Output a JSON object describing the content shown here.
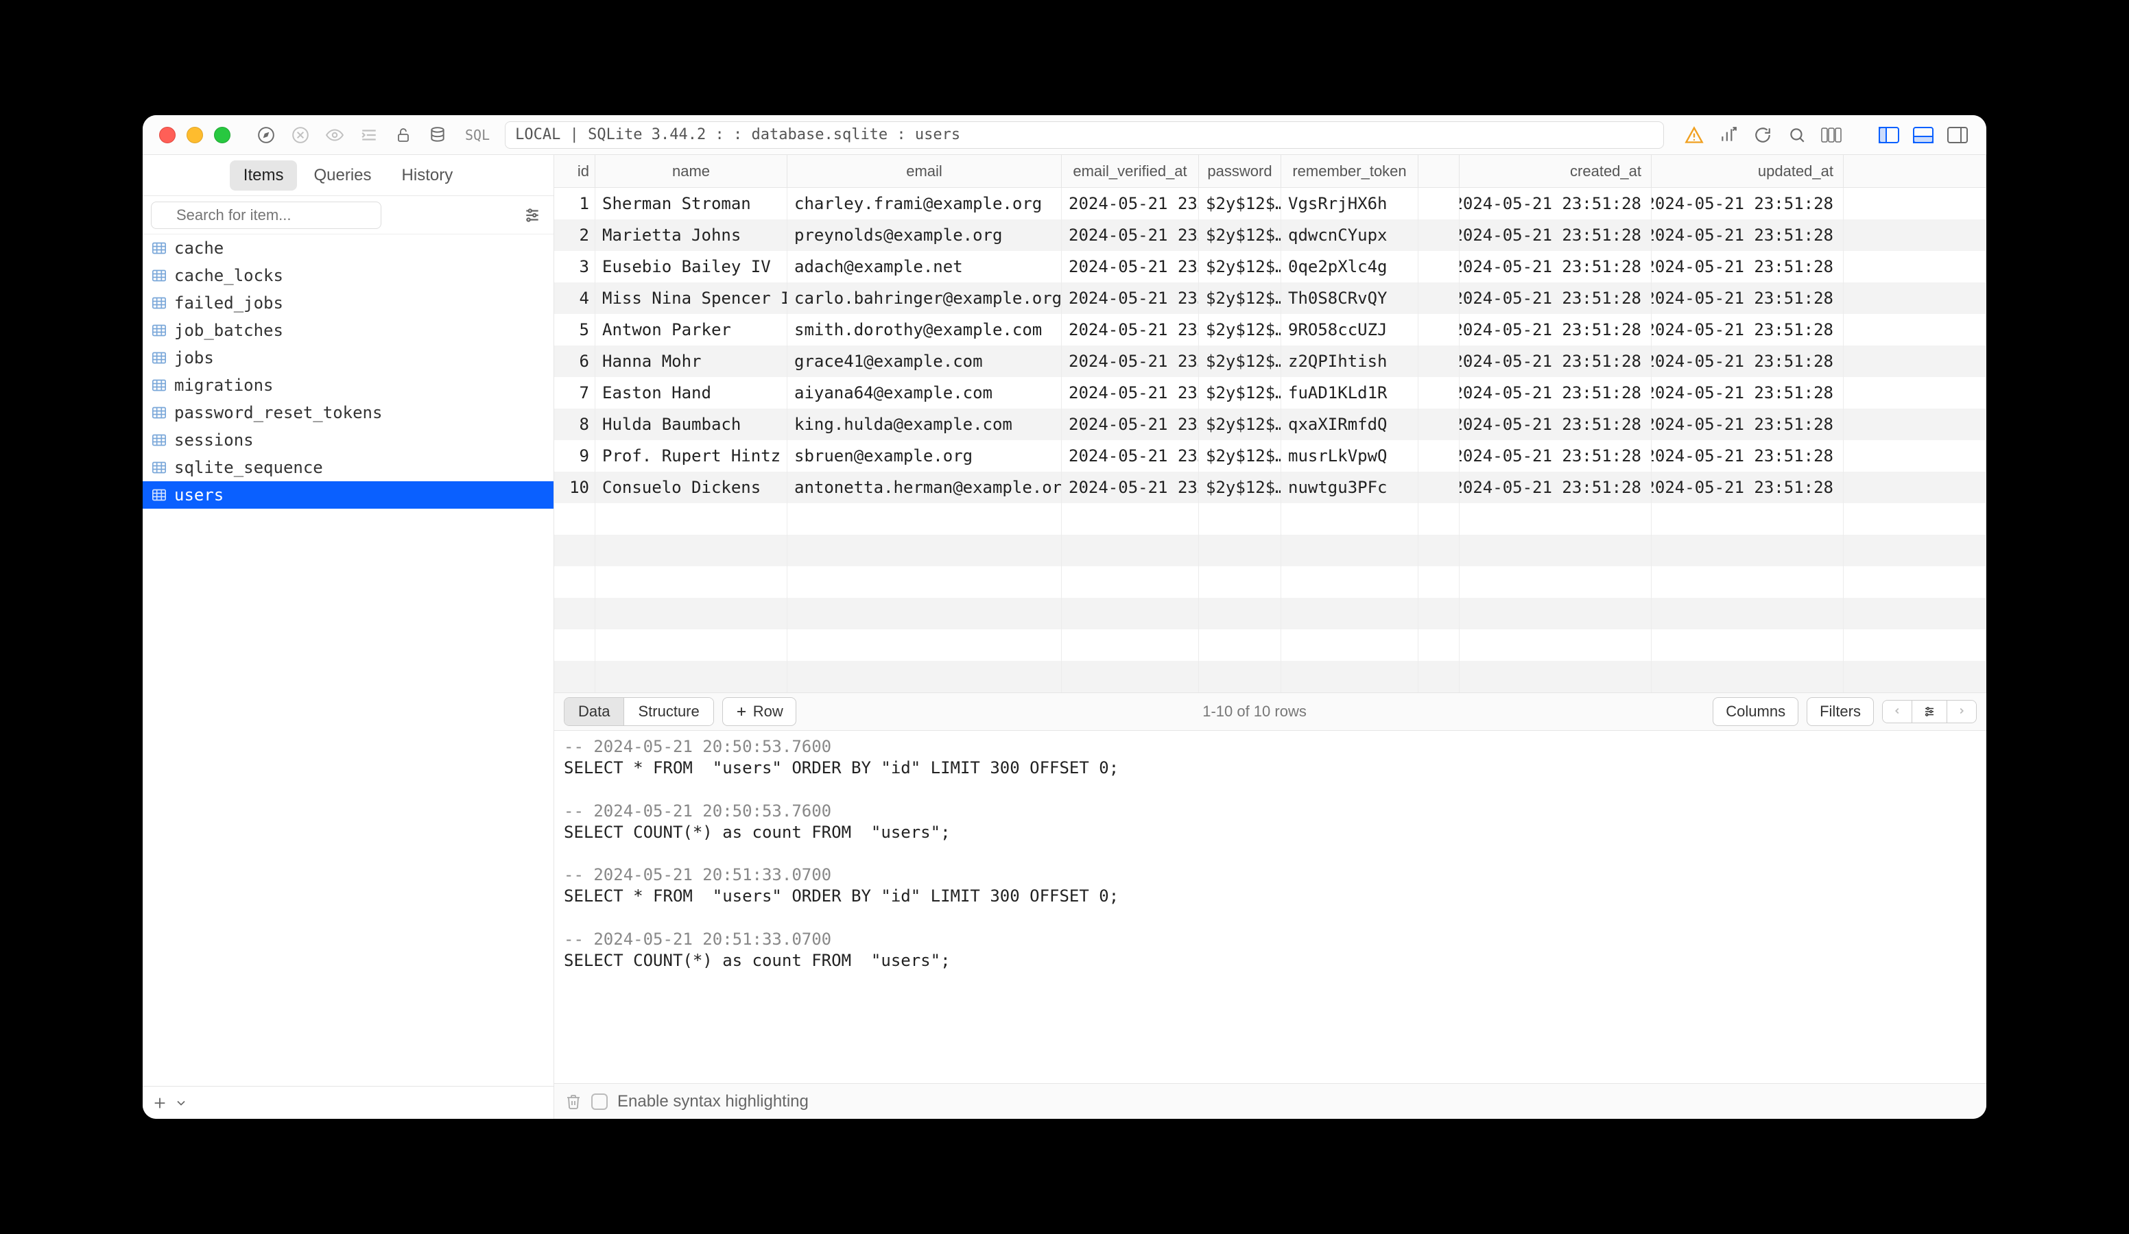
{
  "titlebar": {
    "sql_badge": "SQL",
    "path": "LOCAL | SQLite 3.44.2 :  : database.sqlite : users"
  },
  "sidebar": {
    "tabs": [
      "Items",
      "Queries",
      "History"
    ],
    "active_tab": 0,
    "search_placeholder": "Search for item...",
    "items": [
      "cache",
      "cache_locks",
      "failed_jobs",
      "job_batches",
      "jobs",
      "migrations",
      "password_reset_tokens",
      "sessions",
      "sqlite_sequence",
      "users"
    ],
    "selected_index": 9
  },
  "table": {
    "columns": [
      "id",
      "name",
      "email",
      "email_verified_at",
      "password",
      "remember_token",
      "created_at",
      "updated_at"
    ],
    "rows": [
      {
        "id": "1",
        "name": "Sherman Stroman",
        "email": "charley.frami@example.org",
        "ev": "2024-05-21 23…",
        "pw": "$2y$12$…",
        "rt": "VgsRrjHX6h",
        "ca": "2024-05-21 23:51:28",
        "ua": "2024-05-21 23:51:28"
      },
      {
        "id": "2",
        "name": "Marietta Johns",
        "email": "preynolds@example.org",
        "ev": "2024-05-21 23…",
        "pw": "$2y$12$…",
        "rt": "qdwcnCYupx",
        "ca": "2024-05-21 23:51:28",
        "ua": "2024-05-21 23:51:28"
      },
      {
        "id": "3",
        "name": "Eusebio Bailey IV",
        "email": "adach@example.net",
        "ev": "2024-05-21 23…",
        "pw": "$2y$12$…",
        "rt": "0qe2pXlc4g",
        "ca": "2024-05-21 23:51:28",
        "ua": "2024-05-21 23:51:28"
      },
      {
        "id": "4",
        "name": "Miss Nina Spencer I",
        "email": "carlo.bahringer@example.org",
        "ev": "2024-05-21 23…",
        "pw": "$2y$12$…",
        "rt": "Th0S8CRvQY",
        "ca": "2024-05-21 23:51:28",
        "ua": "2024-05-21 23:51:28"
      },
      {
        "id": "5",
        "name": "Antwon Parker",
        "email": "smith.dorothy@example.com",
        "ev": "2024-05-21 23…",
        "pw": "$2y$12$…",
        "rt": "9RO58ccUZJ",
        "ca": "2024-05-21 23:51:28",
        "ua": "2024-05-21 23:51:28"
      },
      {
        "id": "6",
        "name": "Hanna Mohr",
        "email": "grace41@example.com",
        "ev": "2024-05-21 23…",
        "pw": "$2y$12$…",
        "rt": "z2QPIhtish",
        "ca": "2024-05-21 23:51:28",
        "ua": "2024-05-21 23:51:28"
      },
      {
        "id": "7",
        "name": "Easton Hand",
        "email": "aiyana64@example.com",
        "ev": "2024-05-21 23…",
        "pw": "$2y$12$…",
        "rt": "fuAD1KLd1R",
        "ca": "2024-05-21 23:51:28",
        "ua": "2024-05-21 23:51:28"
      },
      {
        "id": "8",
        "name": "Hulda Baumbach",
        "email": "king.hulda@example.com",
        "ev": "2024-05-21 23…",
        "pw": "$2y$12$…",
        "rt": "qxaXIRmfdQ",
        "ca": "2024-05-21 23:51:28",
        "ua": "2024-05-21 23:51:28"
      },
      {
        "id": "9",
        "name": "Prof. Rupert Hintz",
        "email": "sbruen@example.org",
        "ev": "2024-05-21 23…",
        "pw": "$2y$12$…",
        "rt": "musrLkVpwQ",
        "ca": "2024-05-21 23:51:28",
        "ua": "2024-05-21 23:51:28"
      },
      {
        "id": "10",
        "name": "Consuelo Dickens",
        "email": "antonetta.herman@example.org",
        "ev": "2024-05-21 23…",
        "pw": "$2y$12$…",
        "rt": "nuwtgu3PFc",
        "ca": "2024-05-21 23:51:28",
        "ua": "2024-05-21 23:51:28"
      }
    ]
  },
  "midbar": {
    "seg": [
      "Data",
      "Structure"
    ],
    "seg_active": 0,
    "row_btn": "Row",
    "status": "1-10 of 10 rows",
    "columns_btn": "Columns",
    "filters_btn": "Filters"
  },
  "log": [
    {
      "c": "-- 2024-05-21 20:50:53.7600",
      "q": "SELECT * FROM  \"users\" ORDER BY \"id\" LIMIT 300 OFFSET 0;"
    },
    {
      "c": "-- 2024-05-21 20:50:53.7600",
      "q": "SELECT COUNT(*) as count FROM  \"users\";"
    },
    {
      "c": "-- 2024-05-21 20:51:33.0700",
      "q": "SELECT * FROM  \"users\" ORDER BY \"id\" LIMIT 300 OFFSET 0;"
    },
    {
      "c": "-- 2024-05-21 20:51:33.0700",
      "q": "SELECT COUNT(*) as count FROM  \"users\";"
    }
  ],
  "bottombar": {
    "syntax_label": "Enable syntax highlighting"
  }
}
